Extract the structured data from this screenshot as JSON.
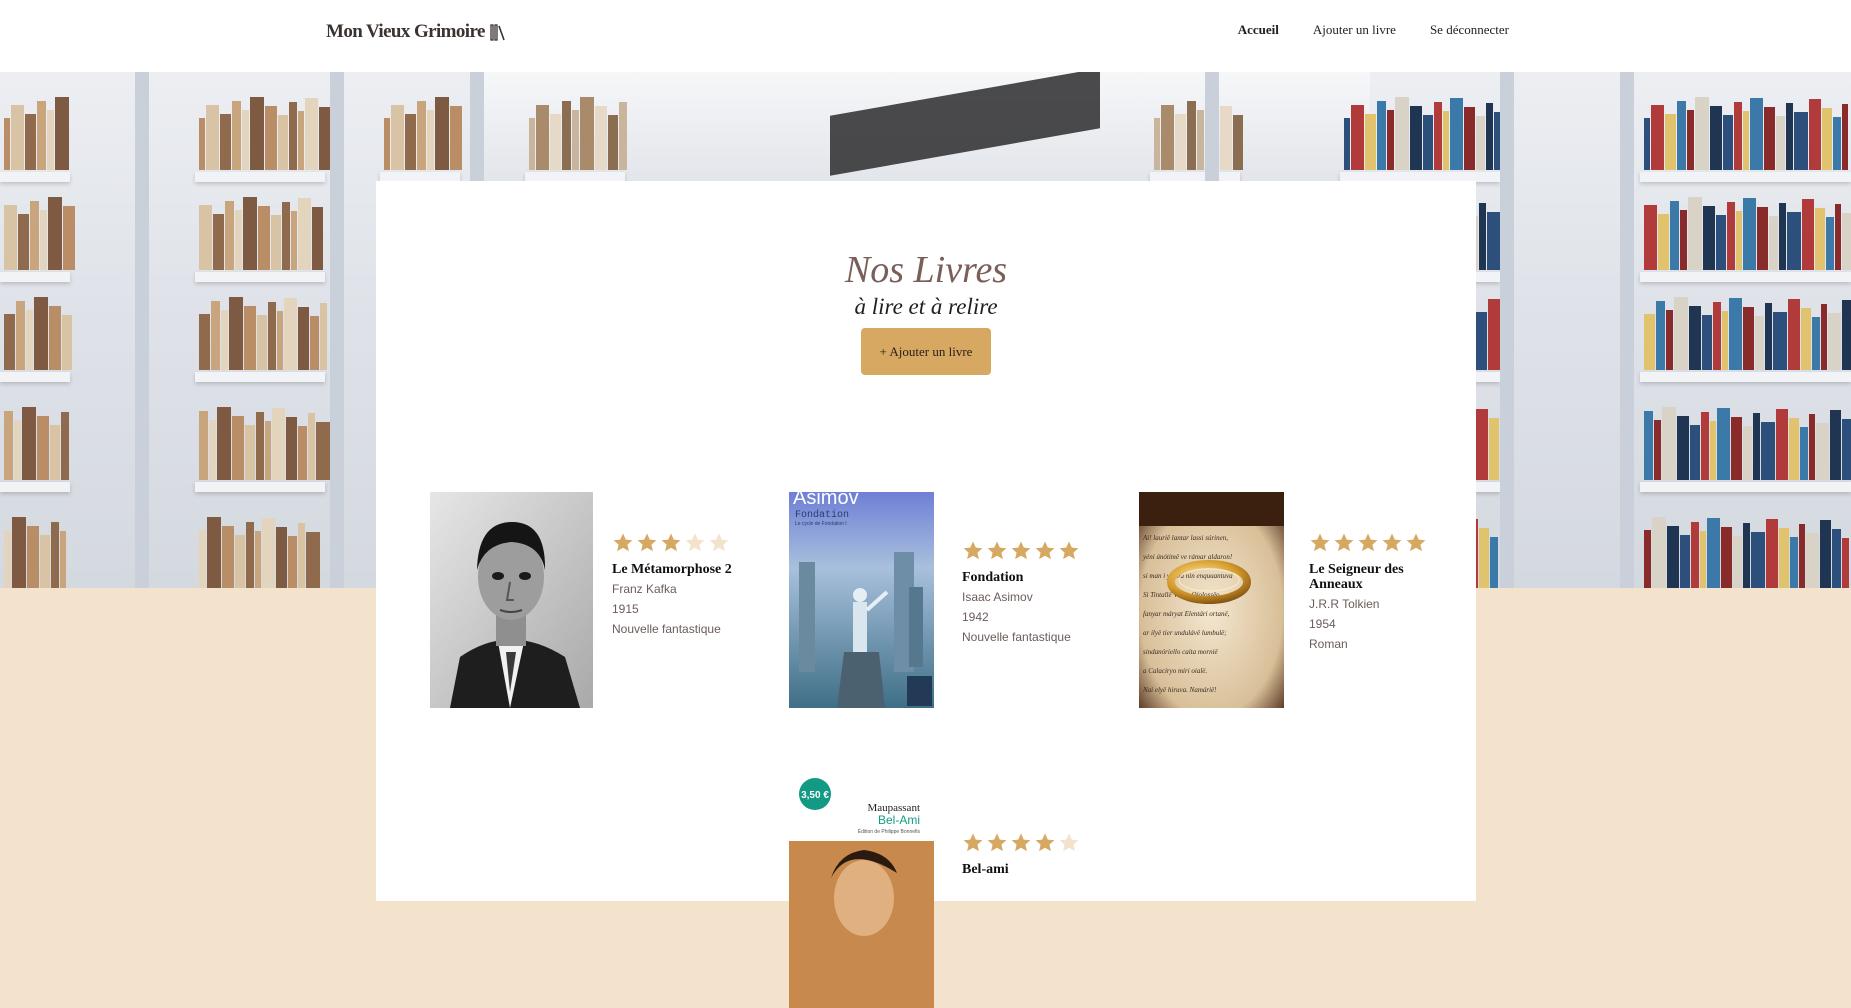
{
  "header": {
    "logo_text": "Mon Vieux Grimoire",
    "nav": [
      {
        "label": "Accueil",
        "active": true
      },
      {
        "label": "Ajouter un livre",
        "active": false
      },
      {
        "label": "Se déconnecter",
        "active": false
      }
    ]
  },
  "main": {
    "title": "Nos Livres",
    "subtitle": "à lire et à relire",
    "add_button": "+ Ajouter un livre"
  },
  "books": [
    {
      "title": "Le Métamorphose 2",
      "author": "Franz Kafka",
      "year": "1915",
      "genre": "Nouvelle fantastique",
      "rating": 3
    },
    {
      "title": "Fondation",
      "author": "Isaac Asimov",
      "year": "1942",
      "genre": "Nouvelle fantastique",
      "rating": 5
    },
    {
      "title": "Le Seigneur des Anneaux",
      "author": "J.R.R Tolkien",
      "year": "1954",
      "genre": "Roman",
      "rating": 5
    },
    {
      "title": "Bel-ami",
      "author": "",
      "year": "",
      "genre": "",
      "rating": 4
    }
  ],
  "covers": {
    "asimov_author": "Asimov",
    "asimov_title": "Fondation",
    "asimov_series": "Le cycle de Fondation I",
    "lotr_text": [
      "Ai! laurië lantar lassi súrinen,",
      "yéni únótimë ve rámar aldaron!",
      "si man i yulma nin enquuantuva",
      "Si Tintallë Varda Oiolossëo",
      "fanyar máryat Elentári ortanë,",
      "ar ilyë tier undulávë lumbulë;",
      "sindanóriello caita mornië",
      "a Calaciryo míri oialë.",
      "Nai elyë hiruva. Namárië!"
    ],
    "belami_price": "3,50 €",
    "belami_author": "Maupassant",
    "belami_title": "Bel-Ami",
    "belami_edition": "Édition de Philippe Bonnefis"
  },
  "colors": {
    "accent": "#d6a861",
    "star_on": "#d6a861",
    "star_off": "#f3e3cd",
    "page_bg": "#f3e3cd"
  }
}
